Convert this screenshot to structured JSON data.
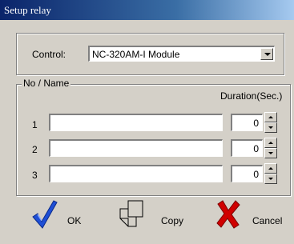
{
  "window": {
    "title": "Setup relay"
  },
  "control": {
    "label": "Control:",
    "selected": "NC-320AM-I Module"
  },
  "relays_group": {
    "legend": "No / Name",
    "duration_header": "Duration(Sec.)",
    "rows": [
      {
        "no": "1",
        "name": "",
        "duration": "0"
      },
      {
        "no": "2",
        "name": "",
        "duration": "0"
      },
      {
        "no": "3",
        "name": "",
        "duration": "0"
      }
    ]
  },
  "buttons": {
    "ok": "OK",
    "copy": "Copy",
    "cancel": "Cancel"
  },
  "colors": {
    "dialog_face": "#d4d0c8",
    "titlebar_start": "#0a246a",
    "titlebar_end": "#a6caf0",
    "ok_check": "#1f4fd6",
    "cancel_x": "#d00000"
  }
}
